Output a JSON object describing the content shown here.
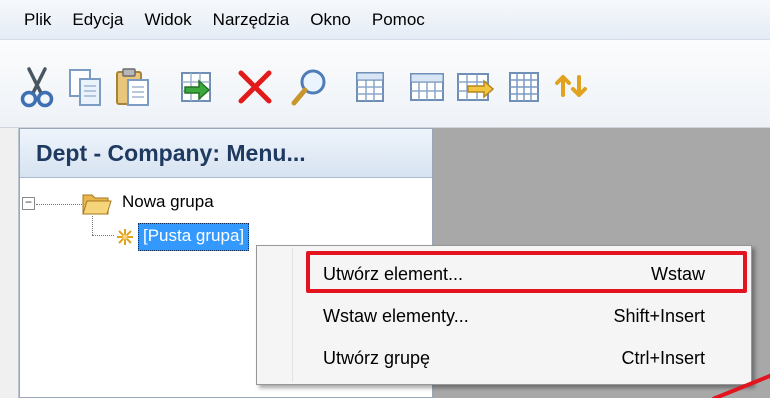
{
  "menubar": {
    "items": [
      "Plik",
      "Edycja",
      "Widok",
      "Narzędzia",
      "Okno",
      "Pomoc"
    ]
  },
  "toolbar": {
    "buttons": [
      "cut-icon",
      "copy-icon",
      "paste-icon",
      "import-icon",
      "delete-icon",
      "search-icon",
      "grid-icon",
      "grid-split-icon",
      "grid-export-icon",
      "grid-table-icon",
      "swap-icon"
    ]
  },
  "panel": {
    "title": "Dept - Company: Menu..."
  },
  "tree": {
    "group_label": "Nowa grupa",
    "empty_group_label": "[Pusta grupa]"
  },
  "context_menu": {
    "items": [
      {
        "label": "Utwórz element...",
        "shortcut": "Wstaw"
      },
      {
        "label": "Wstaw elementy...",
        "shortcut": "Shift+Insert"
      },
      {
        "label": "Utwórz grupę",
        "shortcut": "Ctrl+Insert"
      }
    ]
  },
  "colors": {
    "highlight": "#e3141f",
    "selection": "#3399ff",
    "workspace": "#a8a8a8"
  }
}
